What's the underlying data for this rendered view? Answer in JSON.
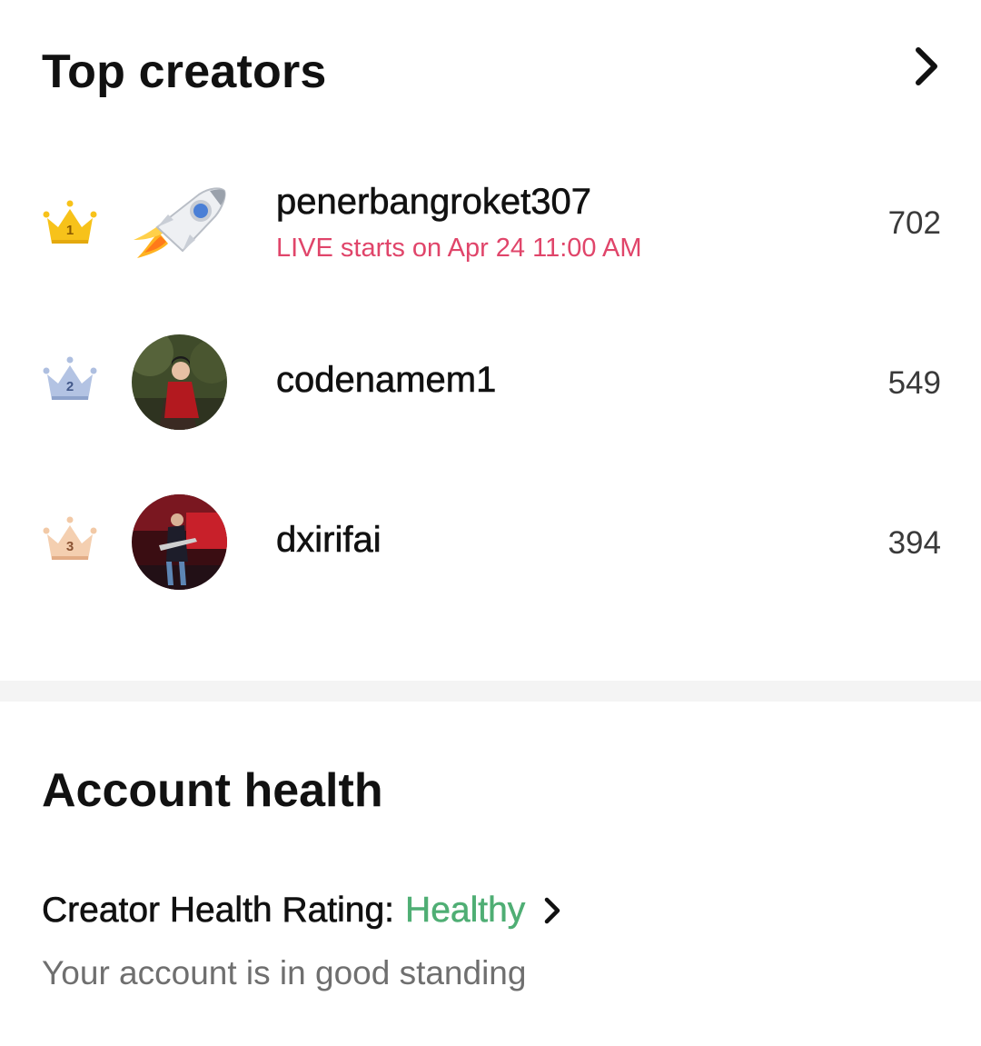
{
  "top_creators": {
    "title": "Top creators",
    "creators": [
      {
        "rank": "1",
        "name": "penerbangroket307",
        "subtitle": "LIVE starts on Apr 24 11:00 AM",
        "score": "702",
        "avatar": "rocket-icon"
      },
      {
        "rank": "2",
        "name": "codenamem1",
        "subtitle": "",
        "score": "549",
        "avatar": "photo"
      },
      {
        "rank": "3",
        "name": "dxirifai",
        "subtitle": "",
        "score": "394",
        "avatar": "photo"
      }
    ],
    "crown_colors": {
      "gold": "#f7c21a",
      "silver": "#9fb3d8",
      "bronze": "#f0c4a0"
    }
  },
  "account_health": {
    "title": "Account health",
    "rating_label": "Creator Health Rating:",
    "rating_value": "Healthy",
    "rating_color": "#4fae74",
    "description": "Your account is in good standing"
  },
  "colors": {
    "live_text": "#e0456a",
    "divider": "#f4f4f4"
  }
}
